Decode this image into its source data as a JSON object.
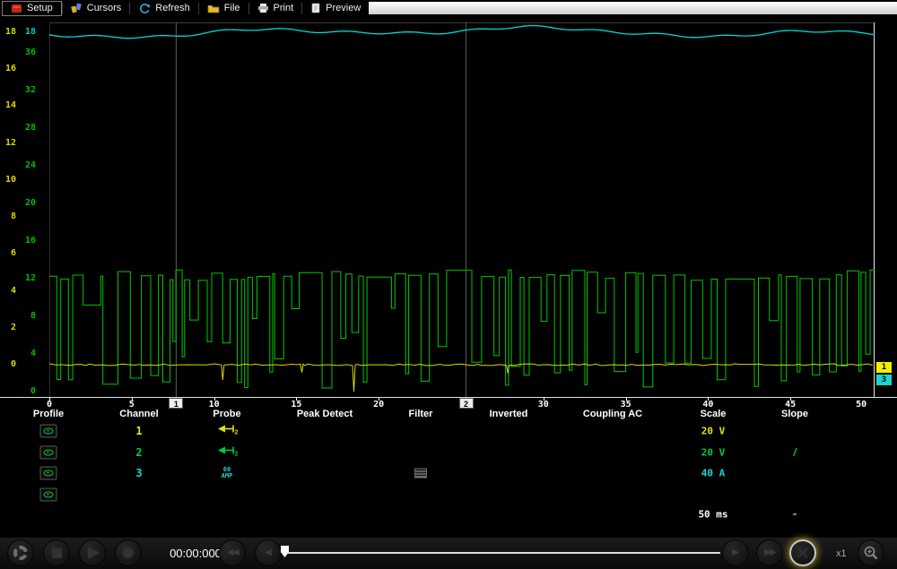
{
  "toolbar": {
    "items": [
      {
        "label": "Setup"
      },
      {
        "label": "Cursors"
      },
      {
        "label": "Refresh"
      },
      {
        "label": "File"
      },
      {
        "label": "Print"
      },
      {
        "label": "Preview"
      }
    ]
  },
  "scope": {
    "y_axis_ch1": {
      "color": "#d9d900",
      "labels": [
        18,
        16,
        14,
        12,
        10,
        8,
        6,
        4,
        2,
        0
      ]
    },
    "y_axis_ch2": {
      "color": "#00bf00",
      "labels": [
        36,
        32,
        28,
        24,
        20,
        16,
        12,
        8,
        4,
        0
      ]
    },
    "y_axis_ch3_top_label": {
      "color": "#00c8c8",
      "value": "18"
    },
    "x_axis": {
      "tick_values": [
        0,
        5,
        10,
        15,
        20,
        30,
        35,
        40,
        45
      ],
      "end_label": "50 ms"
    },
    "time_markers": [
      {
        "label": "1",
        "ms": 7.7
      },
      {
        "label": "2",
        "ms": 25.3
      }
    ],
    "channel_tags": [
      {
        "label": "1",
        "color": "#f0f000"
      },
      {
        "label": "3",
        "color": "#1ad3d3"
      }
    ],
    "traces": {
      "ch1_color": "#d9d900",
      "ch2_color": "#00c800",
      "ch3_color": "#00d9d9"
    }
  },
  "table": {
    "headers": [
      "Profile",
      "Channel",
      "Probe",
      "Peak Detect",
      "Filter",
      "Inverted",
      "Coupling AC",
      "Scale",
      "Slope"
    ],
    "rows": [
      {
        "channel": "1",
        "color": "#e3e300",
        "probe": "attenuator-x2",
        "scale": "20 V",
        "slope": "",
        "filter": false
      },
      {
        "channel": "2",
        "color": "#00cc33",
        "probe": "attenuator-x2",
        "scale": "20 V",
        "slope": "rising",
        "filter": false
      },
      {
        "channel": "3",
        "color": "#1ad3d3",
        "probe": "60 AMP",
        "scale": "40 A",
        "slope": "",
        "filter": true
      },
      {
        "channel": "",
        "color": "",
        "probe": "",
        "scale": "",
        "slope": "",
        "filter": false
      }
    ],
    "timebase": {
      "scale": "50 ms",
      "slope": "-"
    }
  },
  "transport": {
    "timestamp": "00:00:000",
    "zoom_label": "x1"
  }
}
